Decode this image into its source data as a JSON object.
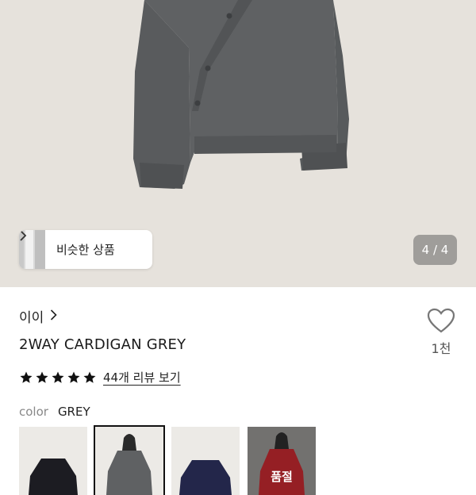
{
  "gallery": {
    "page_indicator": "4 / 4",
    "similar_products_label": "비슷한 상품",
    "product_image_color": "#5f6163"
  },
  "product": {
    "brand": "이이",
    "title": "2WAY CARDIGAN GREY",
    "like_count": "1천",
    "rating_stars": 5,
    "review_link": "44개 리뷰 보기"
  },
  "options": {
    "color_label": "color",
    "selected_color": "GREY",
    "swatches": [
      {
        "name": "black",
        "color": "#1c1c22",
        "selected": false
      },
      {
        "name": "grey",
        "color": "#5f6163",
        "selected": true
      },
      {
        "name": "navy",
        "color": "#23264a",
        "selected": false
      },
      {
        "name": "red",
        "color": "#b6262c",
        "selected": false,
        "overlay_text": "품절"
      }
    ]
  }
}
